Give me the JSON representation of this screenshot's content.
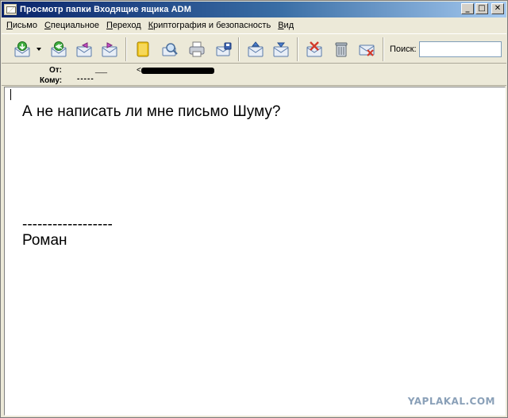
{
  "window": {
    "title": "Просмотр папки Входящие ящика ADM",
    "buttons": {
      "minimize": "_",
      "maximize": "□",
      "close": "✕"
    }
  },
  "menu": [
    {
      "label_u": "П",
      "label_rest": "исьмо"
    },
    {
      "label_u": "С",
      "label_rest": "пециальное"
    },
    {
      "label_u": "П",
      "label_rest": "ереход"
    },
    {
      "label_u": "К",
      "label_rest": "риптография и безопасность"
    },
    {
      "label_u": "В",
      "label_rest": "ид"
    }
  ],
  "toolbar": {
    "icons": [
      "get-mail-icon",
      "reply-all-icon",
      "reply-icon",
      "forward-icon",
      "address-book-icon",
      "find-icon",
      "print-icon",
      "save-icon",
      "move-up-icon",
      "move-down-icon",
      "delete-message-icon",
      "trash-icon",
      "mark-junk-icon"
    ],
    "search_label": "Поиск:",
    "search_value": ""
  },
  "header": {
    "from_label": "От:",
    "from_name": "___",
    "from_address": "<",
    "to_label": "Кому:",
    "to_value": "-----"
  },
  "message": {
    "line1": "А не написать ли мне письмо Шуму?",
    "signature_separator": "------------------",
    "signature_name": "Роман"
  },
  "watermark": "YAPLAKAL.COM",
  "colors": {
    "titlebar_start": "#0a246a",
    "titlebar_end": "#a6caf0",
    "window_bg": "#ece9d8",
    "body_bg": "#ffffff"
  }
}
